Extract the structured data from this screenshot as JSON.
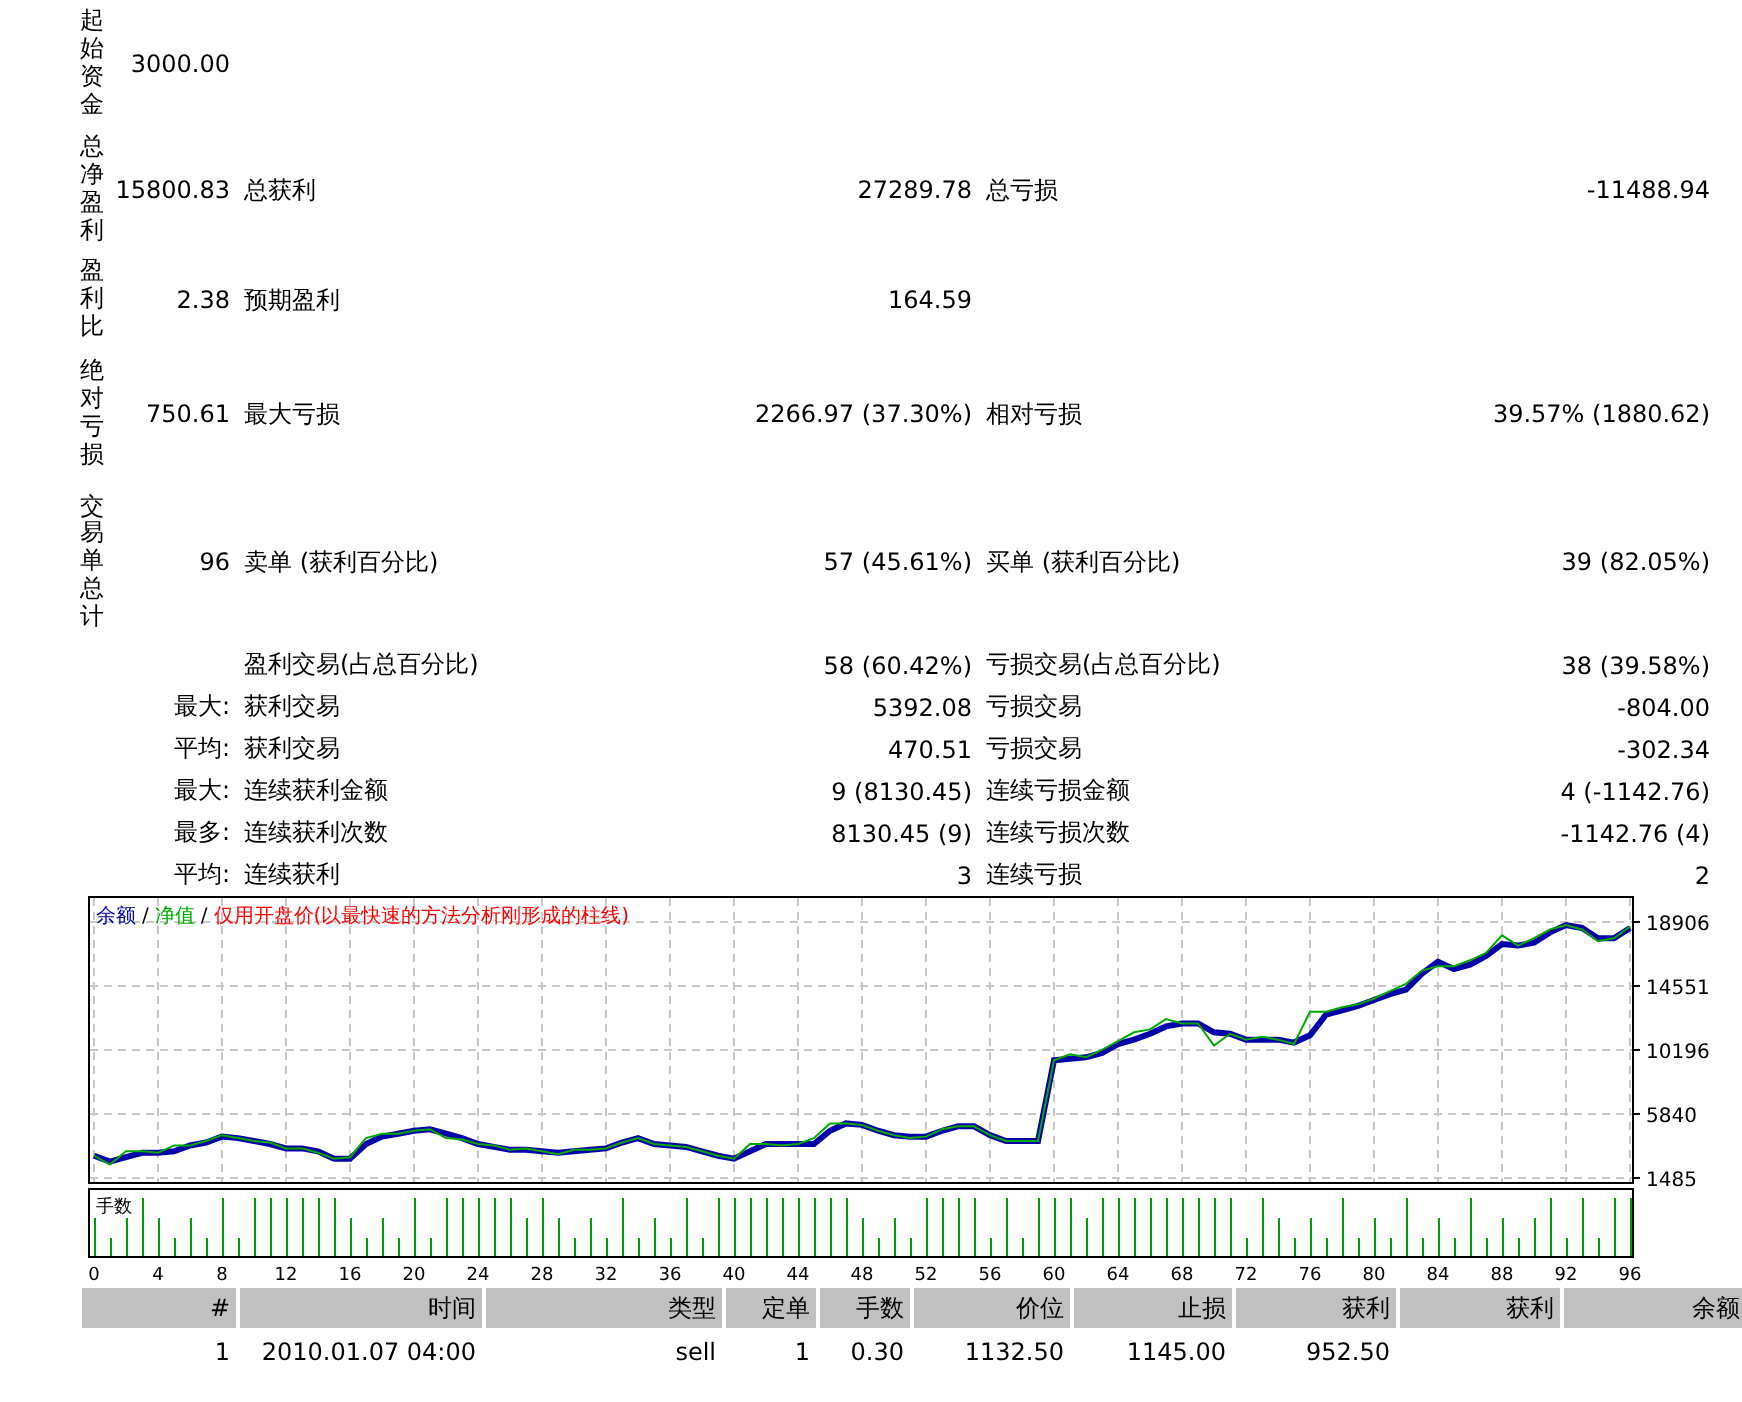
{
  "summary": [
    {
      "kind": "main",
      "label": "起始资金",
      "value": "3000.00"
    },
    {
      "kind": "main",
      "label": "总净盈利",
      "value": "15800.83",
      "pairs": [
        {
          "label": "总获利",
          "value": "27289.78"
        },
        {
          "label": "总亏损",
          "value": "-11488.94"
        }
      ]
    },
    {
      "kind": "main",
      "label": "盈利比",
      "value": "2.38",
      "pairs": [
        {
          "label": "预期盈利",
          "value": "164.59"
        }
      ]
    },
    {
      "kind": "main",
      "label": "绝对亏损",
      "value": "750.61",
      "pairs": [
        {
          "label": "最大亏损",
          "value": "2266.97 (37.30%)"
        },
        {
          "label": "相对亏损",
          "value": "39.57% (1880.62)"
        }
      ]
    },
    {
      "kind": "main",
      "label": "交易单总计",
      "value": "96",
      "pairs": [
        {
          "label": "卖单 (获利百分比)",
          "value": "57 (45.61%)"
        },
        {
          "label": "买单 (获利百分比)",
          "value": "39 (82.05%)"
        }
      ]
    },
    {
      "kind": "sub",
      "pairs": [
        {
          "label": "盈利交易(占总百分比)",
          "value": "58 (60.42%)"
        },
        {
          "label": "亏损交易(占总百分比)",
          "value": "38 (39.58%)"
        }
      ]
    },
    {
      "kind": "sub",
      "prefix": "最大:",
      "pairs": [
        {
          "label": "获利交易",
          "value": "5392.08"
        },
        {
          "label": "亏损交易",
          "value": "-804.00"
        }
      ]
    },
    {
      "kind": "sub",
      "prefix": "平均:",
      "pairs": [
        {
          "label": "获利交易",
          "value": "470.51"
        },
        {
          "label": "亏损交易",
          "value": "-302.34"
        }
      ]
    },
    {
      "kind": "sub",
      "prefix": "最大:",
      "pairs": [
        {
          "label": "连续获利金额",
          "value": "9 (8130.45)"
        },
        {
          "label": "连续亏损金额",
          "value": "4 (-1142.76)"
        }
      ]
    },
    {
      "kind": "sub",
      "prefix": "最多:",
      "pairs": [
        {
          "label": "连续获利次数",
          "value": "8130.45 (9)"
        },
        {
          "label": "连续亏损次数",
          "value": "-1142.76 (4)"
        }
      ]
    },
    {
      "kind": "sub",
      "prefix": "平均:",
      "pairs": [
        {
          "label": "连续获利",
          "value": "3"
        },
        {
          "label": "连续亏损",
          "value": "2"
        }
      ]
    }
  ],
  "chart": {
    "separators": [
      "/",
      "/"
    ],
    "note": {
      "text": "仅用开盘价(以最快速的方法分析刚形成的柱线)",
      "color": "#ff0000"
    },
    "lots_label": "手数",
    "chart_data": {
      "type": "line",
      "grid": true,
      "xlim": [
        0,
        96
      ],
      "ylim": [
        1213,
        20675
      ],
      "x": [
        0,
        1,
        2,
        3,
        4,
        5,
        6,
        7,
        8,
        9,
        10,
        11,
        12,
        13,
        14,
        15,
        16,
        17,
        18,
        19,
        20,
        21,
        22,
        23,
        24,
        25,
        26,
        27,
        28,
        29,
        30,
        31,
        32,
        33,
        34,
        35,
        36,
        37,
        38,
        39,
        40,
        41,
        42,
        43,
        44,
        45,
        46,
        47,
        48,
        49,
        50,
        51,
        52,
        53,
        54,
        55,
        56,
        57,
        58,
        59,
        60,
        61,
        62,
        63,
        64,
        65,
        66,
        67,
        68,
        69,
        70,
        71,
        72,
        73,
        74,
        75,
        76,
        77,
        78,
        79,
        80,
        81,
        82,
        83,
        84,
        85,
        86,
        87,
        88,
        89,
        90,
        91,
        92,
        93,
        94,
        95,
        96
      ],
      "xticks": [
        0,
        4,
        8,
        12,
        16,
        20,
        24,
        28,
        32,
        36,
        40,
        44,
        48,
        52,
        56,
        60,
        64,
        68,
        72,
        76,
        80,
        84,
        88,
        92,
        96
      ],
      "yticks": [
        1485,
        5840,
        10196,
        14551,
        18906
      ],
      "series": [
        {
          "name": "余额",
          "color": "#0000aa",
          "values": [
            3000,
            2600,
            2900,
            3200,
            3200,
            3300,
            3700,
            3900,
            4300,
            4200,
            4000,
            3800,
            3500,
            3500,
            3300,
            2800,
            2800,
            3800,
            4300,
            4500,
            4700,
            4800,
            4500,
            4200,
            3800,
            3600,
            3400,
            3400,
            3300,
            3200,
            3300,
            3400,
            3500,
            3900,
            4200,
            3800,
            3700,
            3600,
            3300,
            3000,
            2800,
            3300,
            3800,
            3800,
            3800,
            3800,
            4700,
            5200,
            5100,
            4700,
            4400,
            4300,
            4300,
            4700,
            5000,
            5000,
            4400,
            4000,
            4000,
            4000,
            9500,
            9600,
            9700,
            10000,
            10600,
            10900,
            11300,
            11800,
            12000,
            12000,
            11400,
            11300,
            10900,
            10900,
            10900,
            10700,
            11200,
            12600,
            12900,
            13200,
            13600,
            14000,
            14300,
            15400,
            16200,
            15700,
            16000,
            16600,
            17400,
            17300,
            17500,
            18200,
            18700,
            18500,
            17800,
            17800,
            18500
          ]
        },
        {
          "name": "净值",
          "color": "#00aa00",
          "values": [
            3000,
            2400,
            3300,
            3300,
            3200,
            3700,
            3700,
            4000,
            4400,
            4200,
            4000,
            3900,
            3500,
            3500,
            3200,
            2800,
            2900,
            4200,
            4500,
            4500,
            4700,
            4800,
            4200,
            4100,
            3800,
            3700,
            3400,
            3500,
            3300,
            3100,
            3400,
            3400,
            3500,
            3900,
            4200,
            3800,
            3700,
            3600,
            3300,
            3000,
            2800,
            3800,
            3800,
            3700,
            3800,
            4200,
            5200,
            5200,
            5100,
            4700,
            4400,
            4200,
            4300,
            4800,
            5000,
            5000,
            4400,
            4000,
            4000,
            4000,
            9500,
            9900,
            9700,
            10200,
            10800,
            11400,
            11600,
            12300,
            12000,
            12000,
            10500,
            11300,
            10900,
            11100,
            10900,
            10600,
            12800,
            12800,
            13100,
            13300,
            13700,
            14200,
            14700,
            15600,
            15900,
            15900,
            16300,
            16800,
            18000,
            17300,
            17800,
            18400,
            18700,
            18400,
            17600,
            17800,
            18600
          ]
        }
      ]
    }
  },
  "table": {
    "columns": [
      "#",
      "时间",
      "类型",
      "定单",
      "手数",
      "价位",
      "止损",
      "获利",
      "获利",
      "余额"
    ],
    "rows": [
      {
        "cells": [
          "1",
          "2010.01.07 04:00",
          "sell",
          "1",
          "0.30",
          "1132.50",
          "1145.00",
          "952.50"
        ]
      }
    ]
  }
}
